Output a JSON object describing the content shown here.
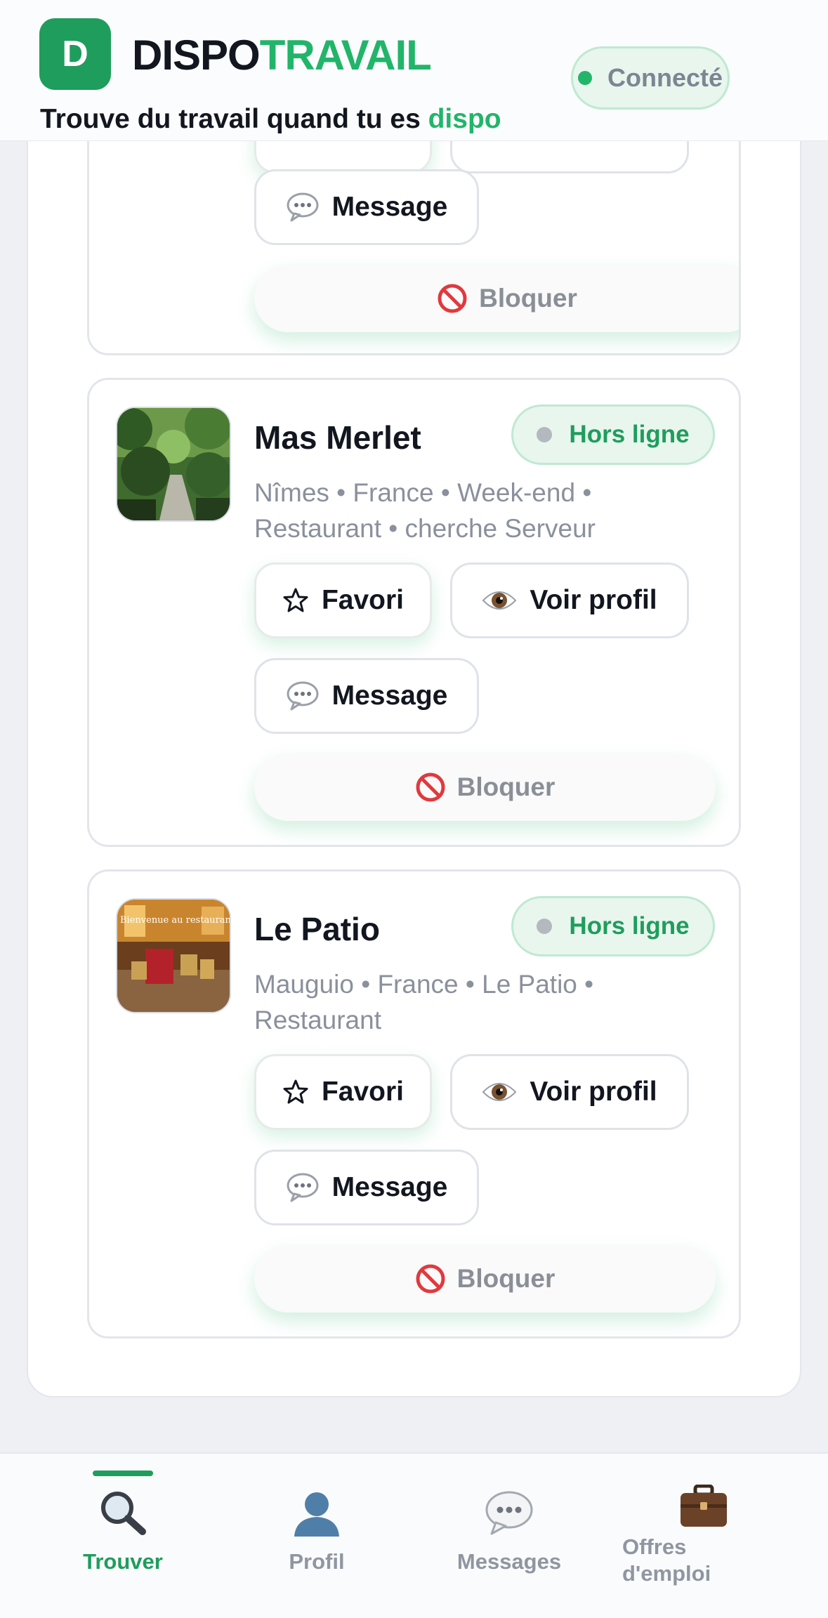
{
  "header": {
    "logo_letter": "D",
    "brand_part1": "DISPO",
    "brand_part2": "TRAVAIL",
    "tagline_main": "Trouve du travail quand tu es ",
    "tagline_accent": "dispo",
    "status": "Connecté",
    "colors": {
      "brand_green": "#1f9d5c",
      "accent_green": "#22b56a"
    }
  },
  "cards": [
    {
      "name": "",
      "message_label": "Message",
      "block_label": "Bloquer"
    },
    {
      "name": "Mas Merlet",
      "status": "Hors ligne",
      "meta_line1": "Nîmes • France • Week-end •",
      "meta_line2": "Restaurant • cherche Serveur",
      "fav_label": "Favori",
      "view_label": "Voir profil",
      "message_label": "Message",
      "block_label": "Bloquer"
    },
    {
      "name": "Le Patio",
      "status": "Hors ligne",
      "meta_line1": "Mauguio • France • Le Patio •",
      "meta_line2": "Restaurant",
      "thumb_caption": "Bienvenue au restaurant",
      "fav_label": "Favori",
      "view_label": "Voir profil",
      "message_label": "Message",
      "block_label": "Bloquer"
    }
  ],
  "bottom_nav": [
    {
      "label": "Trouver",
      "icon": "search-icon",
      "active": true
    },
    {
      "label": "Profil",
      "icon": "user-icon",
      "active": false
    },
    {
      "label": "Messages",
      "icon": "chat-bubble-icon",
      "active": false
    },
    {
      "label": "Offres d'emploi",
      "icon": "briefcase-icon",
      "active": false
    }
  ]
}
